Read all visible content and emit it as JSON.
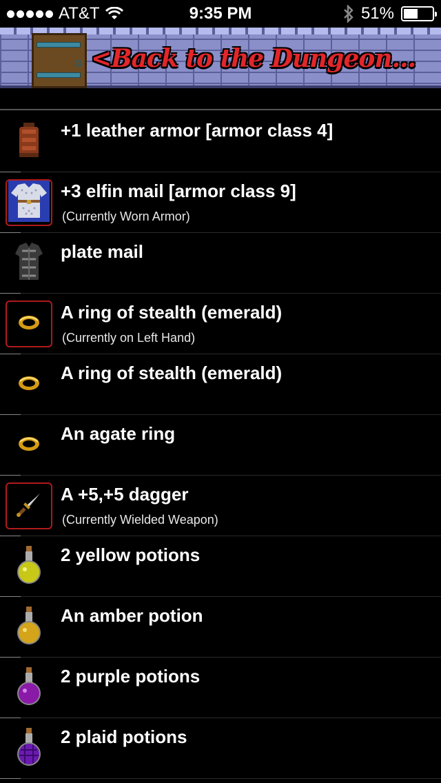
{
  "status_bar": {
    "carrier": "AT&T",
    "time": "9:35 PM",
    "battery": "51%",
    "battery_level": 0.51
  },
  "header": {
    "back_label": "<Back to the Dungeon..."
  },
  "items": [
    {
      "name": "+1 leather armor [armor class 4]",
      "status": "",
      "icon": "leather-armor-icon",
      "selected": false
    },
    {
      "name": "+3 elfin mail [armor class 9]",
      "status": "(Currently Worn Armor)",
      "icon": "elfin-mail-icon",
      "selected": true
    },
    {
      "name": "plate mail",
      "status": "",
      "icon": "plate-mail-icon",
      "selected": false
    },
    {
      "name": "A ring of stealth (emerald)",
      "status": "(Currently on Left Hand)",
      "icon": "ring-icon",
      "selected": true
    },
    {
      "name": "A ring of stealth (emerald)",
      "status": "",
      "icon": "ring-icon",
      "selected": false
    },
    {
      "name": "An agate ring",
      "status": "",
      "icon": "ring-icon",
      "selected": false
    },
    {
      "name": "A +5,+5 dagger",
      "status": "(Currently Wielded Weapon)",
      "icon": "dagger-icon",
      "selected": true
    },
    {
      "name": "2 yellow potions",
      "status": "",
      "icon": "yellow-potion-icon",
      "selected": false
    },
    {
      "name": "An amber potion",
      "status": "",
      "icon": "amber-potion-icon",
      "selected": false
    },
    {
      "name": "2 purple potions",
      "status": "",
      "icon": "purple-potion-icon",
      "selected": false
    },
    {
      "name": "2 plaid potions",
      "status": "",
      "icon": "plaid-potion-icon",
      "selected": false
    }
  ],
  "colors": {
    "selected_border": "#b01a1a",
    "banner_text": "#e2262a"
  }
}
